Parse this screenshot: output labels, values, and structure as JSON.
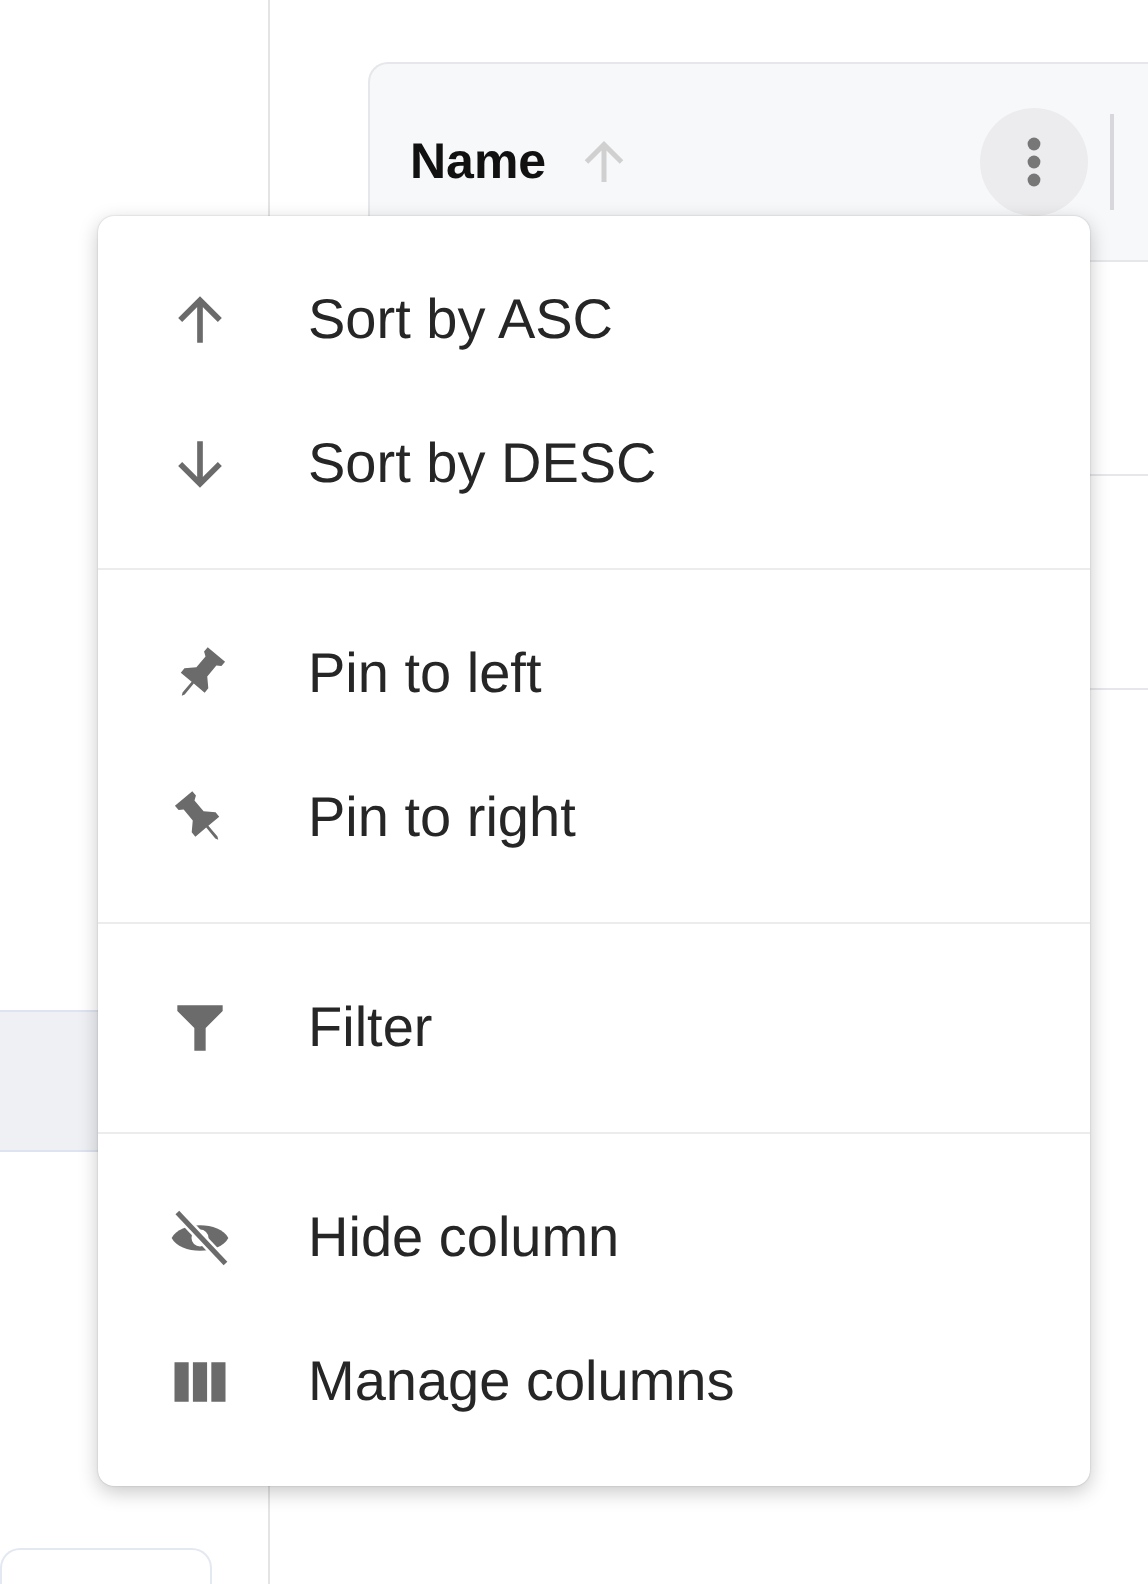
{
  "column_header": {
    "label": "Name"
  },
  "column_menu": {
    "sections": [
      {
        "items": [
          {
            "kind": "arrow_up",
            "label": "Sort by ASC"
          },
          {
            "kind": "arrow_down",
            "label": "Sort by DESC"
          }
        ]
      },
      {
        "items": [
          {
            "kind": "pin_left",
            "label": "Pin to left"
          },
          {
            "kind": "pin_right",
            "label": "Pin to right"
          }
        ]
      },
      {
        "items": [
          {
            "kind": "filter",
            "label": "Filter"
          }
        ]
      },
      {
        "items": [
          {
            "kind": "hide",
            "label": "Hide column"
          },
          {
            "kind": "columns",
            "label": "Manage columns"
          }
        ]
      }
    ]
  }
}
